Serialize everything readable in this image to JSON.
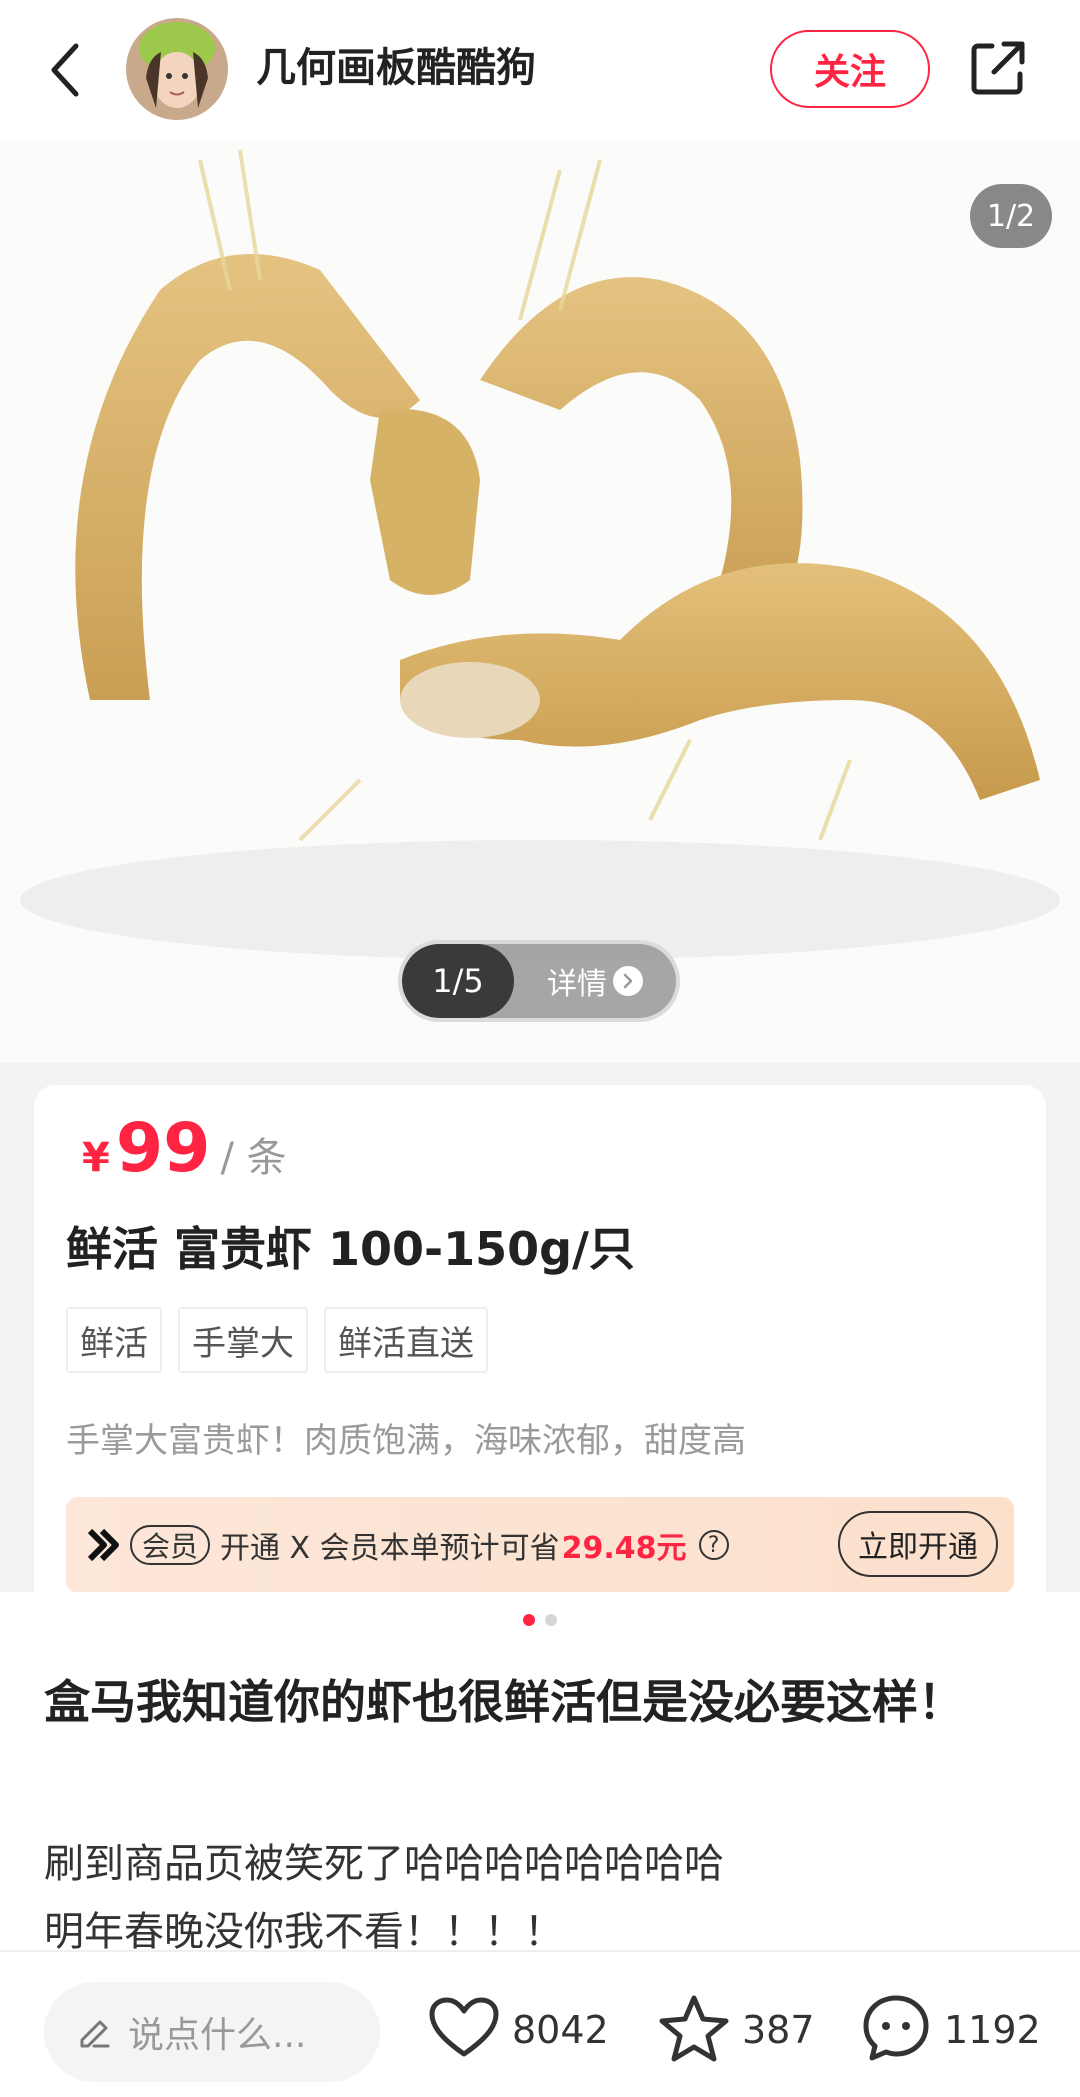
{
  "header": {
    "author_name": "几何画板酷酷狗",
    "follow_label": "关注"
  },
  "media": {
    "image_counter": "1/2",
    "product_page_counter": "1/5",
    "detail_label": "详情"
  },
  "product": {
    "currency": "¥",
    "price": "99",
    "unit": "/ 条",
    "title": "鲜活 富贵虾 100-150g/只",
    "tags": [
      "鲜活",
      "手掌大",
      "鲜活直送"
    ],
    "description": "手掌大富贵虾！肉质饱满，海味浓郁，甜度高",
    "vip": {
      "badge": "会员",
      "text": "开通 X 会员本单预计可省",
      "amount": "29.48元",
      "help": "?",
      "button": "立即开通"
    }
  },
  "note": {
    "title": "盒马我知道你的虾也很鲜活但是没必要这样！",
    "body_line1": "刷到商品页被笑死了哈哈哈哈哈哈哈哈",
    "body_line2": "明年春晚没你我不看！！！！"
  },
  "bottom_bar": {
    "comment_placeholder": "说点什么...",
    "likes": "8042",
    "collects": "387",
    "comments": "1192"
  },
  "colors": {
    "accent": "#ff2442",
    "vip_bg": "#fde7d9"
  }
}
